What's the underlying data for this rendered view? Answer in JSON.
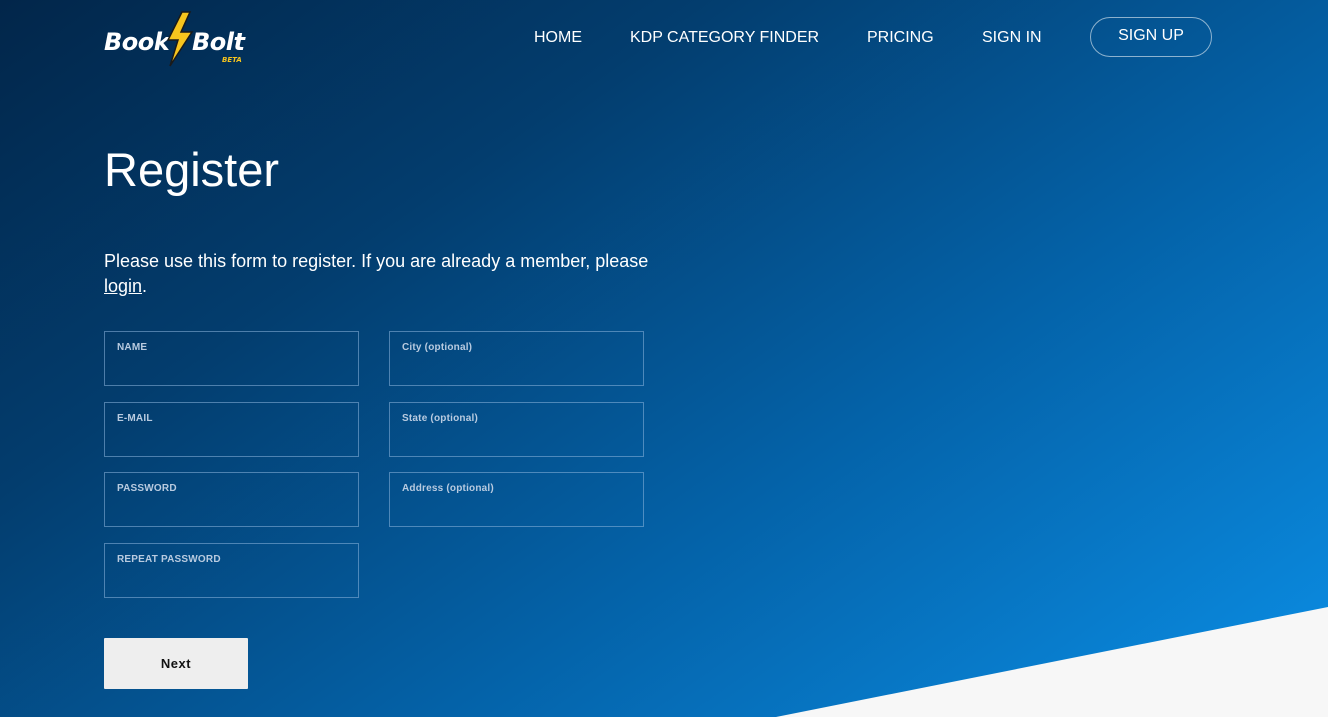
{
  "brand": {
    "word1": "Book",
    "word2": "Bolt",
    "badge": "BETA",
    "icon": "lightning-bolt-icon",
    "accent_color": "#f7c51e"
  },
  "nav": {
    "home": "HOME",
    "kdp_category_finder": "KDP CATEGORY FINDER",
    "pricing": "PRICING",
    "sign_in": "SIGN IN",
    "sign_up": "SIGN UP"
  },
  "page": {
    "title": "Register",
    "intro_text": "Please use this form to register. If you are already a member, please ",
    "login_link": "login",
    "intro_end": "."
  },
  "form": {
    "name": {
      "label": "NAME",
      "value": ""
    },
    "email": {
      "label": "E-MAIL",
      "value": ""
    },
    "password": {
      "label": "PASSWORD",
      "value": ""
    },
    "repeat_password": {
      "label": "REPEAT PASSWORD",
      "value": ""
    },
    "city": {
      "label": "City (optional)",
      "value": ""
    },
    "state": {
      "label": "State (optional)",
      "value": ""
    },
    "address": {
      "label": "Address (optional)",
      "value": ""
    },
    "next_label": "Next"
  },
  "colors": {
    "background_dark": "#02264a",
    "background_light": "#0b8fe6",
    "wedge": "#f7f7f7"
  }
}
